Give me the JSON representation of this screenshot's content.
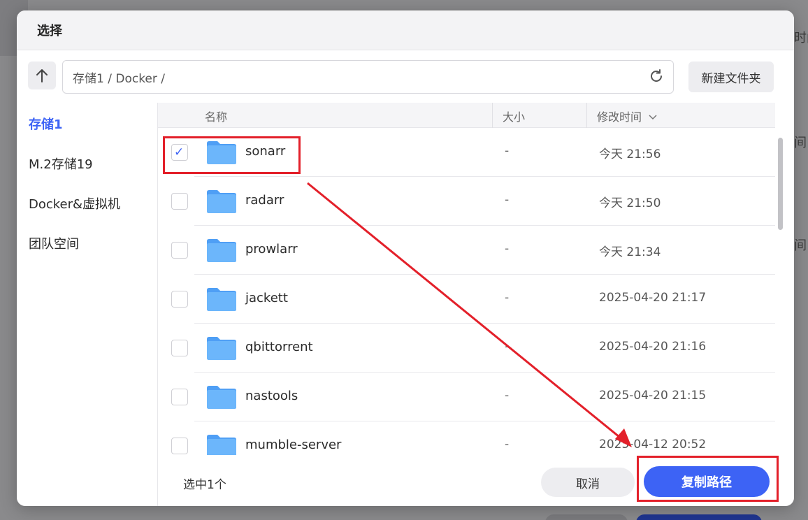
{
  "background": {
    "right_texts": [
      "时间",
      "间",
      "间"
    ]
  },
  "dialog": {
    "title": "选择",
    "path": "存储1 / Docker /",
    "new_folder_label": "新建文件夹",
    "sidebar": [
      {
        "label": "存储1",
        "active": true
      },
      {
        "label": "M.2存储19",
        "active": false
      },
      {
        "label": "Docker&虚拟机",
        "active": false
      },
      {
        "label": "团队空间",
        "active": false
      }
    ],
    "columns": {
      "name": "名称",
      "size": "大小",
      "modified": "修改时间",
      "sort_icon": "chevron-down-icon"
    },
    "files": [
      {
        "name": "sonarr",
        "size": "-",
        "modified": "今天 21:56",
        "checked": true
      },
      {
        "name": "radarr",
        "size": "-",
        "modified": "今天 21:50",
        "checked": false
      },
      {
        "name": "prowlarr",
        "size": "-",
        "modified": "今天 21:34",
        "checked": false
      },
      {
        "name": "jackett",
        "size": "-",
        "modified": "2025-04-20 21:17",
        "checked": false
      },
      {
        "name": "qbittorrent",
        "size": "-",
        "modified": "2025-04-20 21:16",
        "checked": false
      },
      {
        "name": "nastools",
        "size": "-",
        "modified": "2025-04-20 21:15",
        "checked": false
      },
      {
        "name": "mumble-server",
        "size": "-",
        "modified": "2025-04-12 20:52",
        "checked": false
      }
    ],
    "selected_count": "选中1个",
    "cancel_label": "取消",
    "copy_path_label": "复制路径"
  },
  "colors": {
    "accent": "#3d63f5",
    "annotation": "#e3202a",
    "folder": "#5aa9f8"
  }
}
